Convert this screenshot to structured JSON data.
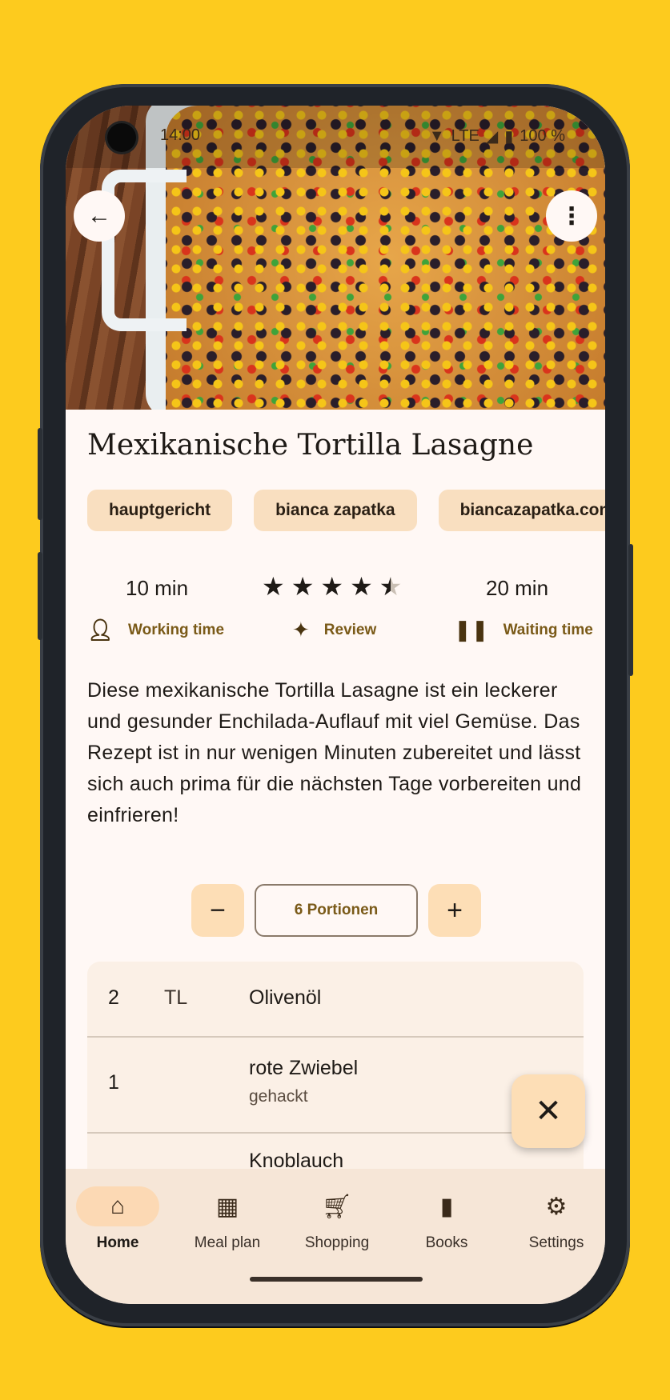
{
  "status_bar": {
    "time": "14:00",
    "network": "LTE",
    "battery": "100 %"
  },
  "recipe": {
    "title": "Mexikanische Tortilla Lasagne",
    "tags": [
      "hauptgericht",
      "bianca zapatka",
      "biancazapatka.com"
    ],
    "working_time": {
      "value": "10 min",
      "label": "Working time",
      "icon": "person-icon"
    },
    "review": {
      "rating": 4.5,
      "max": 5,
      "label": "Review",
      "icon": "rate-review-icon"
    },
    "waiting_time": {
      "value": "20 min",
      "label": "Waiting time",
      "icon": "pause-icon"
    },
    "description": "Diese mexikanische Tortilla Lasagne ist ein leckerer und gesunder Enchilada-Auflauf mit viel Gemüse. Das Rezept ist in nur wenigen Minuten zubereitet und lässt sich auch prima für die nächsten Tage vorbereiten und einfrieren!",
    "portions_label": "6 Portionen",
    "ingredients": [
      {
        "amount": "2",
        "unit": "TL",
        "name": "Olivenöl",
        "note": ""
      },
      {
        "amount": "1",
        "unit": "",
        "name": "rote Zwiebel",
        "note": "gehackt"
      },
      {
        "amount": "",
        "unit": "",
        "name": "Knoblauch",
        "note": ""
      }
    ]
  },
  "nav": {
    "items": [
      {
        "label": "Home",
        "icon": "home-icon",
        "active": true
      },
      {
        "label": "Meal plan",
        "icon": "calendar-icon",
        "active": false
      },
      {
        "label": "Shopping",
        "icon": "cart-icon",
        "active": false
      },
      {
        "label": "Books",
        "icon": "book-icon",
        "active": false
      },
      {
        "label": "Settings",
        "icon": "gear-icon",
        "active": false
      }
    ]
  },
  "colors": {
    "background": "#FDCB1E",
    "surface": "#FFF8F5",
    "chip": "#F9DFC0",
    "accent_text": "#7a5a18",
    "nav_active": "#FCD9B4"
  }
}
